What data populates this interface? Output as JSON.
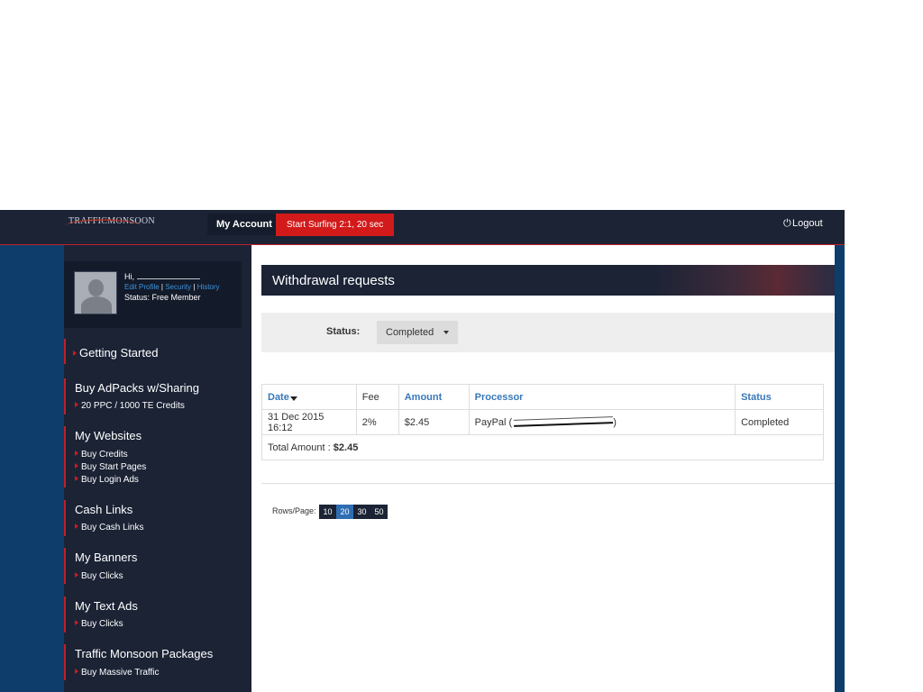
{
  "header": {
    "logo_text": "TRAFFICMONSOON",
    "nav": {
      "my_account": "My Account",
      "start_surfing": "Start Surfing 2:1, 20 sec",
      "logout": "Logout"
    }
  },
  "profile": {
    "greeting": "Hi,",
    "links": [
      "Edit Profile",
      "Security",
      "History"
    ],
    "status": "Status: Free Member"
  },
  "sidebar": {
    "sections": [
      {
        "title": "Getting Started",
        "items": []
      },
      {
        "title": "Buy AdPacks w/Sharing",
        "items": [
          "20 PPC / 1000 TE Credits"
        ]
      },
      {
        "title": "My Websites",
        "items": [
          "Buy Credits",
          "Buy Start Pages",
          "Buy Login Ads"
        ]
      },
      {
        "title": "Cash Links",
        "items": [
          "Buy Cash Links"
        ]
      },
      {
        "title": "My Banners",
        "items": [
          "Buy Clicks"
        ]
      },
      {
        "title": "My Text Ads",
        "items": [
          "Buy Clicks"
        ]
      },
      {
        "title": "Traffic Monsoon Packages",
        "items": [
          "Buy Massive Traffic"
        ]
      }
    ]
  },
  "main": {
    "title": "Withdrawal requests",
    "filter": {
      "label": "Status:",
      "value": "Completed"
    },
    "table": {
      "headers": [
        "Date",
        "Fee",
        "Amount",
        "Processor",
        "Status"
      ],
      "rows": [
        {
          "date": "31 Dec 2015 16:12",
          "fee": "2%",
          "amount": "$2.45",
          "processor_prefix": "PayPal (",
          "processor_suffix": ")",
          "status": "Completed"
        }
      ],
      "total_label": "Total Amount :",
      "total_value": "$2.45"
    },
    "pagination": {
      "label": "Rows/Page:",
      "options": [
        "10",
        "20",
        "30",
        "50"
      ],
      "selected": "20"
    }
  },
  "colors": {
    "navy": "#1b2335",
    "blue_frame": "#0e3d6b",
    "accent_red": "#d21a1a",
    "link_blue": "#3878b9"
  }
}
